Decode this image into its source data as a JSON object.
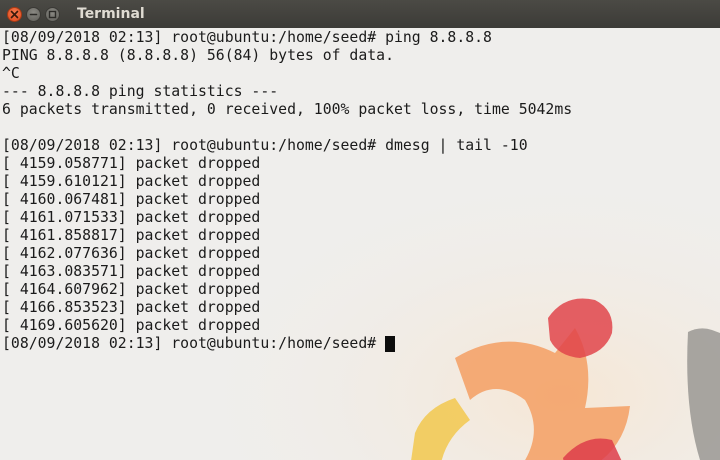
{
  "window": {
    "title": "Terminal",
    "controls": {
      "close": "close-icon",
      "minimize": "minimize-icon",
      "maximize": "maximize-icon"
    }
  },
  "colors": {
    "titlebar": "#3c3b37",
    "terminal_bg": "#efeeec",
    "text": "#1b1b1b",
    "close_button": "#e95420"
  },
  "terminal": {
    "lines": [
      "[08/09/2018 02:13] root@ubuntu:/home/seed# ping 8.8.8.8",
      "PING 8.8.8.8 (8.8.8.8) 56(84) bytes of data.",
      "^C",
      "--- 8.8.8.8 ping statistics ---",
      "6 packets transmitted, 0 received, 100% packet loss, time 5042ms",
      "",
      "[08/09/2018 02:13] root@ubuntu:/home/seed# dmesg | tail -10",
      "[ 4159.058771] packet dropped",
      "[ 4159.610121] packet dropped",
      "[ 4160.067481] packet dropped",
      "[ 4161.071533] packet dropped",
      "[ 4161.858817] packet dropped",
      "[ 4162.077636] packet dropped",
      "[ 4163.083571] packet dropped",
      "[ 4164.607962] packet dropped",
      "[ 4166.853523] packet dropped",
      "[ 4169.605620] packet dropped"
    ],
    "prompt": "[08/09/2018 02:13] root@ubuntu:/home/seed#",
    "background_logo": "ubuntu-logo-watermark"
  }
}
